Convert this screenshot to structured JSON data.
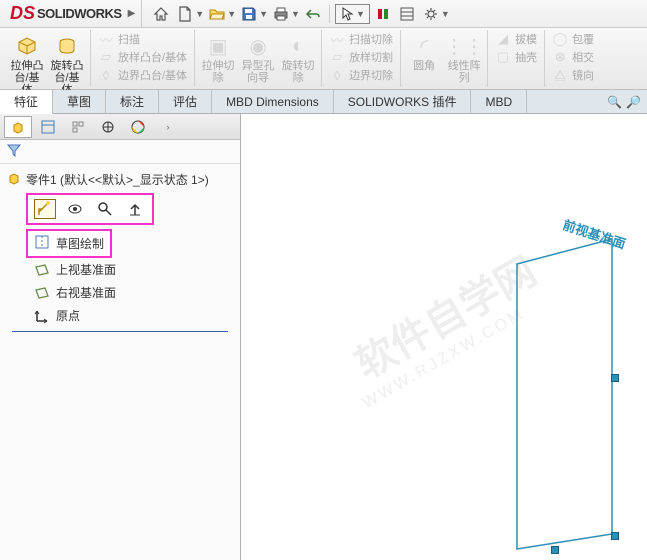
{
  "app": {
    "name": "SOLIDWORKS"
  },
  "qat": {
    "home": "home-icon",
    "new": "new-icon",
    "open": "open-icon",
    "save": "save-icon",
    "print": "print-icon",
    "undo": "undo-icon",
    "rebuild": "rebuild-icon",
    "options": "options-icon",
    "settings": "gear-icon"
  },
  "ribbon": {
    "extrude": "拉伸凸台/基体",
    "revolve": "旋转凸台/基体",
    "sweep": "扫描",
    "loft": "放样凸台/基体",
    "boundary": "边界凸台/基体",
    "extrudeCut": "拉伸切除",
    "holeWizard": "异型孔向导",
    "revolveCut": "旋转切除",
    "sweepCut": "扫描切除",
    "loftCut": "放样切割",
    "boundaryCut": "边界切除",
    "fillet": "圆角",
    "pattern": "线性阵列",
    "wrap": "包覆",
    "intersect": "相交",
    "shell": "抽壳",
    "mirror": "镜向",
    "draft": "拔模"
  },
  "tabs": {
    "feature": "特征",
    "sketch": "草图",
    "annotate": "标注",
    "evaluate": "评估",
    "mbd": "MBD Dimensions",
    "addins": "SOLIDWORKS 插件",
    "mbd2": "MBD"
  },
  "tree": {
    "root": "零件1 (默认<<默认>_显示状态 1>)",
    "sketchDraw": "草图绘制",
    "topPlane": "上视基准面",
    "rightPlane": "右视基准面",
    "origin": "原点"
  },
  "viewport": {
    "watermark": "软件自学网",
    "watermark_url": "WWW.RJZXW.COM",
    "planeLabel": "前视基准面"
  }
}
